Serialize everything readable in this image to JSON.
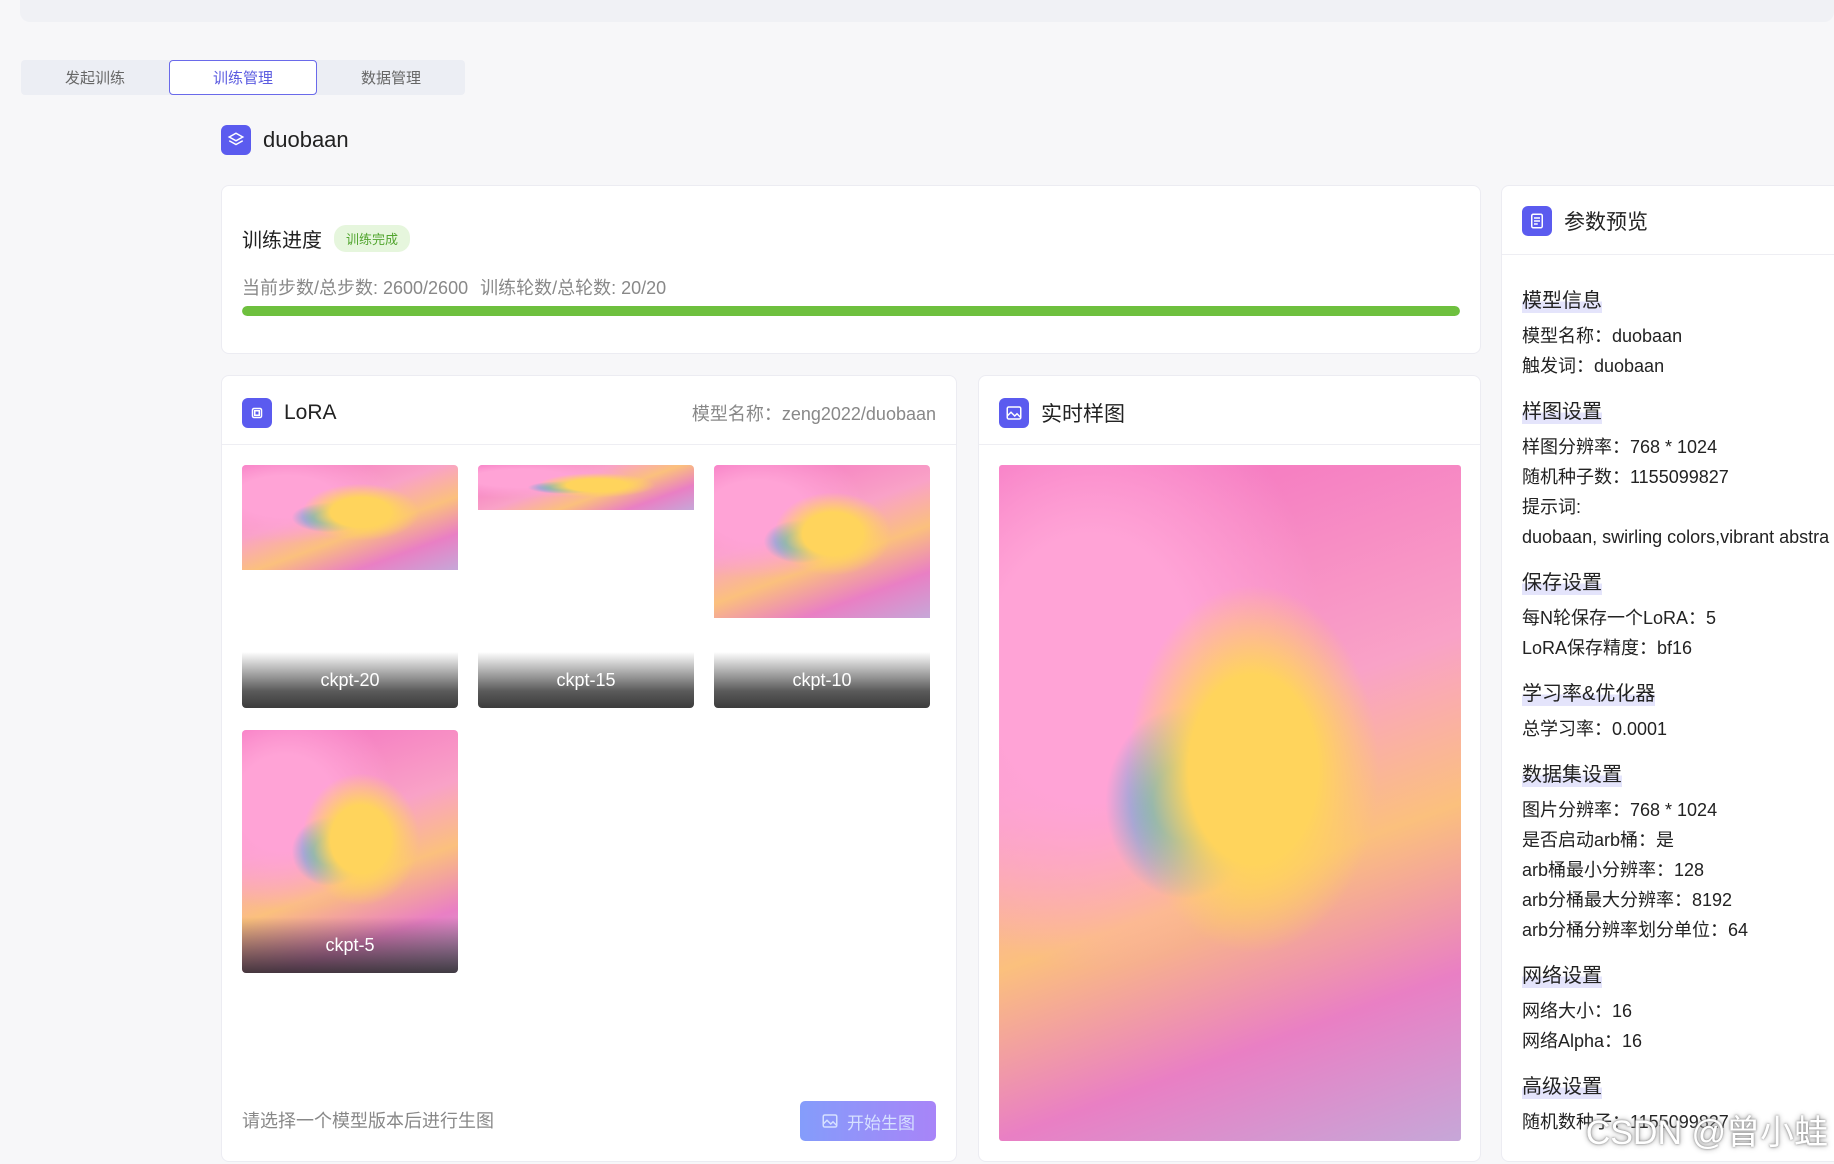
{
  "tabs": [
    {
      "label": "发起训练",
      "active": false
    },
    {
      "label": "训练管理",
      "active": true
    },
    {
      "label": "数据管理",
      "active": false
    }
  ],
  "project": {
    "name": "duobaan",
    "icon": "layers-icon"
  },
  "progress": {
    "title": "训练进度",
    "status": "训练完成",
    "steps_text": "当前步数/总步数: 2600/2600",
    "epochs_text": "训练轮数/总轮数: 20/20",
    "percent": 100,
    "bar_color": "#6ec03e"
  },
  "lora": {
    "title": "LoRA",
    "model_name": "模型名称：zeng2022/duobaan",
    "checkpoints": [
      "ckpt-20",
      "ckpt-15",
      "ckpt-10",
      "ckpt-5"
    ],
    "footer_note": "请选择一个模型版本后进行生图",
    "generate_label": "开始生图"
  },
  "sample": {
    "title": "实时样图"
  },
  "params": {
    "title": "参数预览",
    "sections": [
      {
        "title": "模型信息",
        "rows": [
          "模型名称：duobaan",
          "触发词：duobaan"
        ]
      },
      {
        "title": "样图设置",
        "rows": [
          "样图分辨率：768 * 1024",
          "随机种子数：1155099827",
          "提示词:",
          "duobaan, swirling colors,vibrant abstra"
        ]
      },
      {
        "title": "保存设置",
        "rows": [
          "每N轮保存一个LoRA：5",
          "LoRA保存精度：bf16"
        ]
      },
      {
        "title": "学习率&优化器",
        "rows": [
          "总学习率：0.0001"
        ]
      },
      {
        "title": "数据集设置",
        "rows": [
          "图片分辨率：768 * 1024",
          "是否启动arb桶：是",
          "arb桶最小分辨率：128",
          "arb分桶最大分辨率：8192",
          "arb分桶分辨率划分单位：64"
        ]
      },
      {
        "title": "网络设置",
        "rows": [
          "网络大小：16",
          "网络Alpha：16"
        ]
      },
      {
        "title": "高级设置",
        "rows": [
          "随机数种子：1155099827"
        ]
      }
    ]
  },
  "watermark": "CSDN @曾小蛙",
  "colors": {
    "accent": "#5b5bef",
    "success": "#6ec03e"
  }
}
